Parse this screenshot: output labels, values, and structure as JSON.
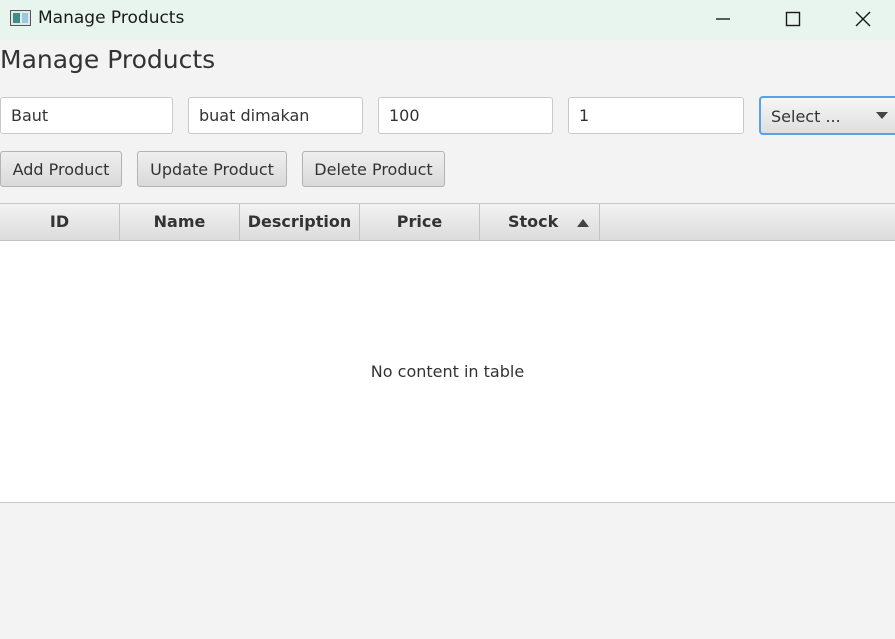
{
  "window": {
    "title": "Manage Products",
    "controls": {
      "minimize": "minimize-icon",
      "maximize": "maximize-icon",
      "close": "close-icon"
    }
  },
  "page": {
    "title": "Manage Products"
  },
  "form": {
    "name_value": "Baut",
    "description_value": "buat dimakan",
    "price_value": "100",
    "stock_value": "1",
    "category_select": "Select ..."
  },
  "buttons": {
    "add": "Add Product",
    "update": "Update Product",
    "delete": "Delete Product"
  },
  "table": {
    "columns": [
      "ID",
      "Name",
      "Description",
      "Price",
      "Stock"
    ],
    "sorted_column": "Stock",
    "sort_direction": "ascending",
    "rows": [],
    "empty_message": "No content in table"
  },
  "colors": {
    "titlebar": "#e8f5ef",
    "background": "#f3f3f3",
    "focus_border": "#56a3e6"
  }
}
